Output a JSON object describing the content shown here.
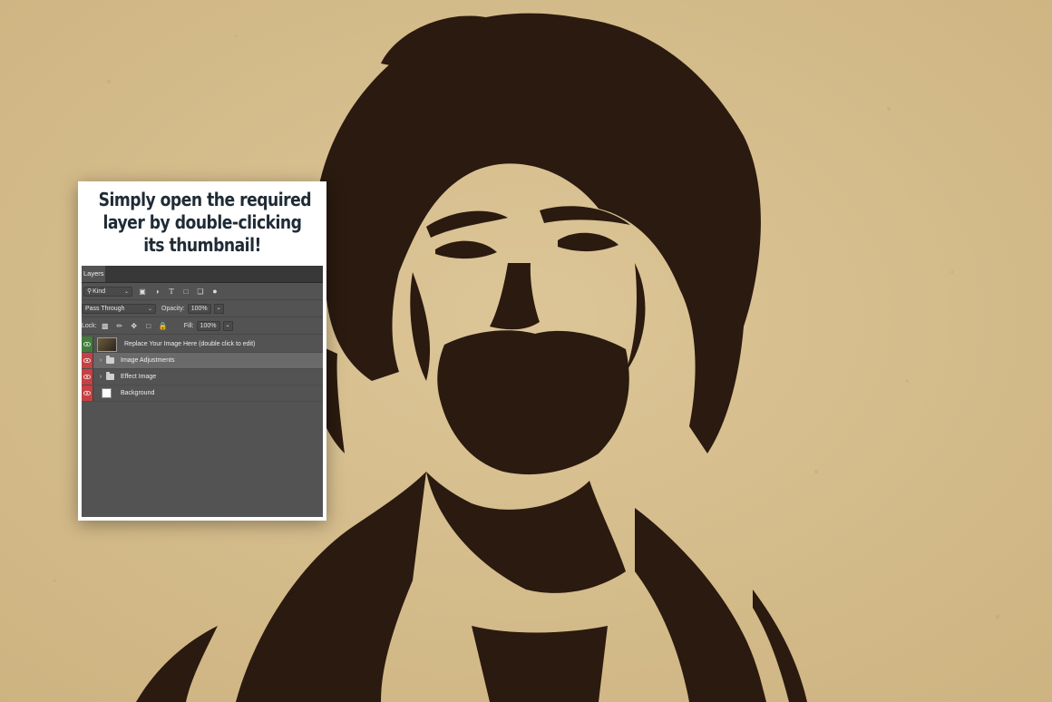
{
  "caption": {
    "line1": "Simply open the required",
    "line2": "layer by double-clicking",
    "line3": "its thumbnail!"
  },
  "layers_panel": {
    "tab_label": "Layers",
    "filter": {
      "kind_label": "Kind"
    },
    "blend": {
      "mode": "Pass Through",
      "opacity_label": "Opacity:",
      "opacity_value": "100%"
    },
    "lock": {
      "label": "Lock:",
      "fill_label": "Fill:",
      "fill_value": "100%"
    },
    "layers": [
      {
        "name": "Replace Your Image Here (double click to edit)",
        "type": "smart-object",
        "visible": true
      },
      {
        "name": "Image Adjustments",
        "type": "group",
        "visible": true,
        "selected": true
      },
      {
        "name": "Effect Image",
        "type": "group",
        "visible": true
      },
      {
        "name": "Background",
        "type": "layer",
        "visible": true
      }
    ]
  },
  "colors": {
    "paper": "#d8c08f",
    "ink": "#2a1a10",
    "panel_bg": "#535353",
    "eye_green": "#3f7e3a",
    "eye_red": "#c74043"
  }
}
